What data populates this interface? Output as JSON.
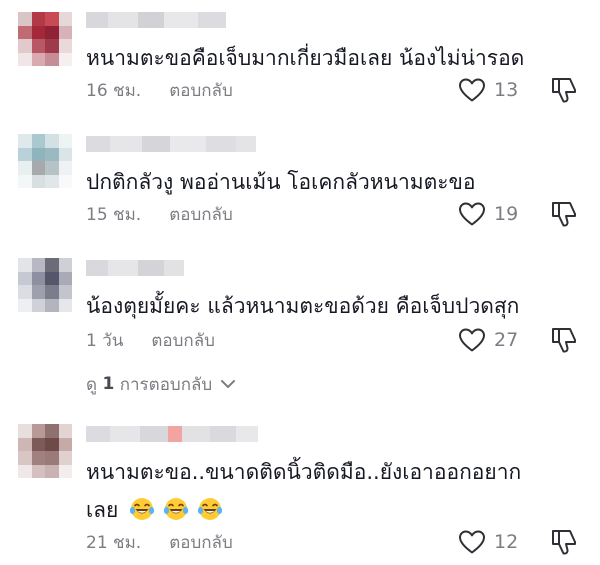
{
  "comments": [
    {
      "text": "หนามตะขอคือเจ็บมากเกี่ยวมือเลย น้องไม่น่ารอด",
      "time": "16 ชม.",
      "reply_label": "ตอบกลับ",
      "likes": "13"
    },
    {
      "text": "ปกติกลัวงู พออ่านเม้น โอเคกลัวหนามตะขอ",
      "time": "15 ชม.",
      "reply_label": "ตอบกลับ",
      "likes": "19"
    },
    {
      "text": "น้องตุยมั้ยคะ แล้วหนามตะขอด้วย คือเจ็บปวดสุก",
      "time": "1 วัน",
      "reply_label": "ตอบกลับ",
      "likes": "27"
    },
    {
      "text_line1": "หนามตะขอ..ขนาดติดนิ้วติดมือ..ยังเอาออกอยาก",
      "text_line2": "เลย",
      "time": "21 ชม.",
      "reply_label": "ตอบกลับ",
      "likes": "12"
    }
  ],
  "view_replies": {
    "prefix": "ดู ",
    "count": "1",
    "suffix": " การตอบกลับ"
  },
  "icons": {
    "like": "heart-outline-icon",
    "dislike": "thumbs-down-icon",
    "expand": "chevron-down-icon",
    "emoji": "tears-of-joy-emoji"
  },
  "colors": {
    "text": "#161823",
    "secondary": "#7c7d83",
    "icon": "#2f3036"
  }
}
